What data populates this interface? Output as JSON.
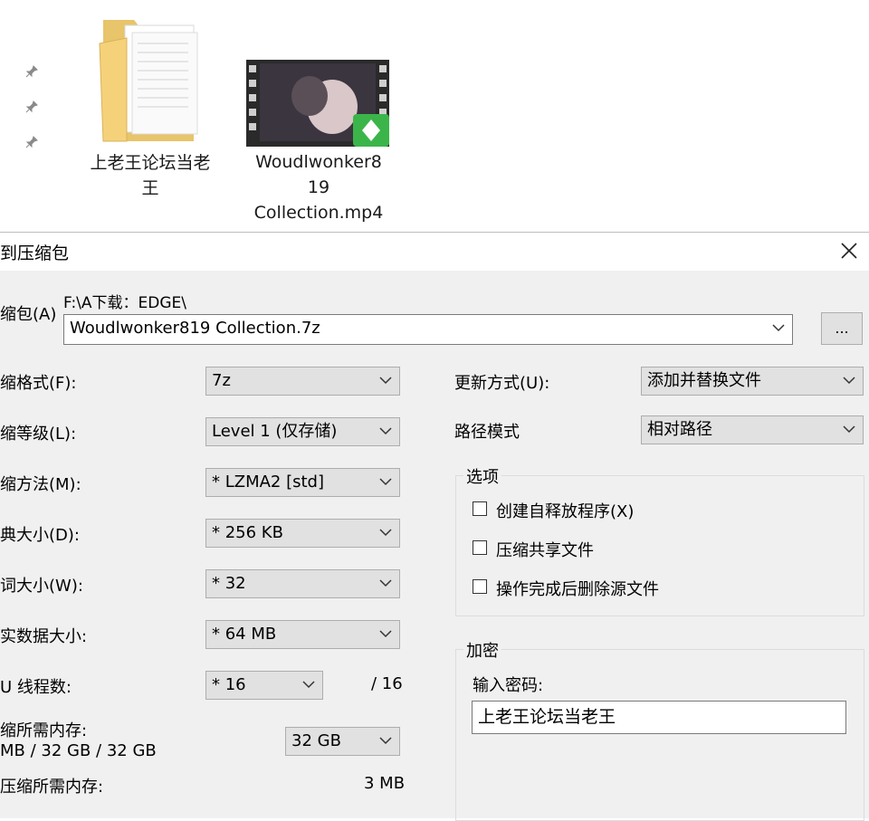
{
  "explorer": {
    "folder_label_line1": "上老王论坛当老",
    "folder_label_line2": "王",
    "video_label_line1": "Woudlwonker8",
    "video_label_line2": "19",
    "video_label_line3": "Collection.mp4"
  },
  "dialog": {
    "title": "到压缩包",
    "close_glyph": "✕",
    "archive": {
      "label": "缩包(A)",
      "path": "F:\\A下载：EDGE\\",
      "value": "Woudlwonker819 Collection.7z",
      "browse_label": "..."
    },
    "left_rows": [
      {
        "label": "缩格式(F):",
        "value": "7z"
      },
      {
        "label": "缩等级(L):",
        "value": "Level 1 (仅存储)"
      },
      {
        "label": "缩方法(M):",
        "value": "*  LZMA2 [std]"
      },
      {
        "label": "典大小(D):",
        "value": "*  256 KB"
      },
      {
        "label": "词大小(W):",
        "value": "*  32"
      },
      {
        "label": "实数据大小:",
        "value": "*  64 MB"
      }
    ],
    "threads": {
      "label": "U 线程数:",
      "value": "*  16",
      "max": "/ 16"
    },
    "mem_compress": {
      "label_line1": "缩所需内存:",
      "label_line2": "MB / 32 GB / 32 GB",
      "value": "32 GB"
    },
    "mem_decompress": {
      "label": "压缩所需内存:",
      "value": "3 MB"
    },
    "update_mode": {
      "label": "更新方式(U):",
      "value": "添加并替换文件"
    },
    "path_mode": {
      "label": "路径模式",
      "value": "相对路径"
    },
    "options": {
      "title": "选项",
      "items": [
        "创建自释放程序(X)",
        "压缩共享文件",
        "操作完成后删除源文件"
      ]
    },
    "encryption": {
      "title": "加密",
      "password_label": "输入密码:",
      "password_value": "上老王论坛当老王"
    }
  }
}
